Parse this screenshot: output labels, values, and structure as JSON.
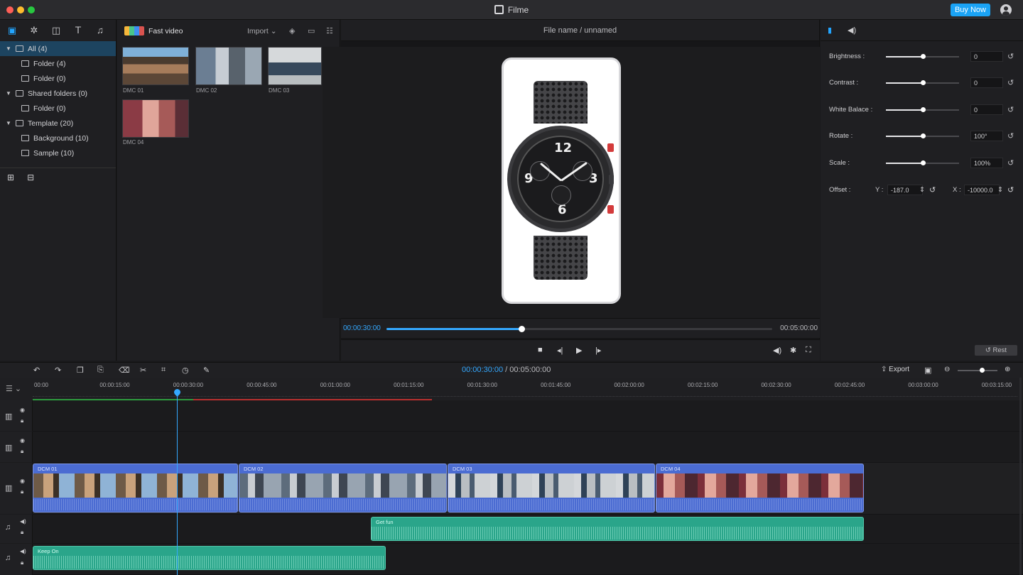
{
  "app": {
    "title": "Filme",
    "buy_label": "Buy Now"
  },
  "library": {
    "toolbar_icons": [
      "media-icon",
      "effects-icon",
      "transition-icon",
      "text-icon",
      "music-icon"
    ],
    "tree": [
      {
        "label": "All (4)",
        "level": 1,
        "expanded": true,
        "selected": true
      },
      {
        "label": "Folder (4)",
        "level": 2
      },
      {
        "label": "Folder (0)",
        "level": 2
      },
      {
        "label": "Shared folders (0)",
        "level": 1,
        "expanded": true
      },
      {
        "label": "Folder (0)",
        "level": 2
      },
      {
        "label": "Template (20)",
        "level": 1,
        "expanded": true
      },
      {
        "label": "Background (10)",
        "level": 2
      },
      {
        "label": "Sample (10)",
        "level": 2
      }
    ]
  },
  "media": {
    "fast_video_label": "Fast video",
    "import_label": "Import",
    "items": [
      {
        "caption": "DMC 01"
      },
      {
        "caption": "DMC 02"
      },
      {
        "caption": "DMC 03"
      },
      {
        "caption": "DMC 04"
      }
    ]
  },
  "preview": {
    "file_name": "File name / unnamed",
    "current_time": "00:00:30:00",
    "total_time": "00:05:00:00",
    "progress": 0.35
  },
  "properties": {
    "rows": [
      {
        "label": "Brightness :",
        "value": "0",
        "level": 0.5
      },
      {
        "label": "Contrast :",
        "value": "0",
        "level": 0.5
      },
      {
        "label": "White Balace :",
        "value": "0",
        "level": 0.5
      },
      {
        "label": "Rotate :",
        "value": "100°",
        "level": 0.5
      },
      {
        "label": "Scale :",
        "value": "100%",
        "level": 0.5
      }
    ],
    "offset": {
      "label": "Offset :",
      "y_label": "Y :",
      "y_value": "-187.0",
      "x_label": "X :",
      "x_value": "-10000.0"
    },
    "reset_label": "Rest"
  },
  "timeline": {
    "current_time": "00:00:30:00",
    "separator": " / ",
    "total_time": "00:05:00:00",
    "export_label": "Export",
    "zoom_level": 0.6,
    "ticks": [
      "00:00",
      "00:00:15:00",
      "00:00:30:00",
      "00:00:45:00",
      "00:01:00:00",
      "00:01:15:00",
      "00:01:30:00",
      "00:01:45:00",
      "00:02:00:00",
      "00:02:15:00",
      "00:02:30:00",
      "00:02:45:00",
      "00:03:00:00",
      "00:03:15:00"
    ],
    "video_clips": [
      {
        "name": "DCM 01"
      },
      {
        "name": "DCM 02"
      },
      {
        "name": "DCM 03"
      },
      {
        "name": "DCM 04"
      }
    ],
    "audio_clips": [
      {
        "name": "Get fun"
      },
      {
        "name": "Keep On"
      }
    ]
  },
  "colors": {
    "accent": "#34a8ff",
    "buy_button": "#1aa3f5",
    "video_clip": "#4b6cd2",
    "audio_clip": "#2aa58a",
    "marker_green": "#2e9b3e",
    "marker_red": "#b8302f"
  }
}
